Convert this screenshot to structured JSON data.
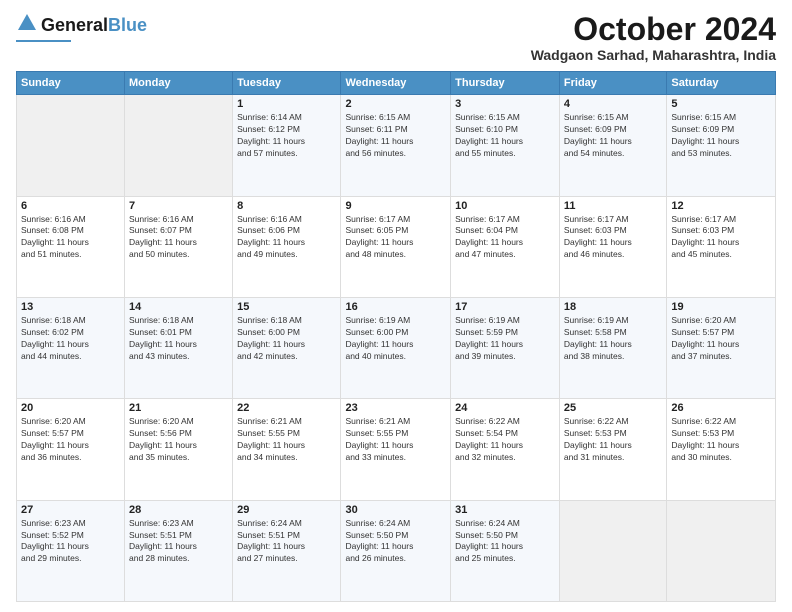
{
  "header": {
    "logo_line1": "General",
    "logo_line2": "Blue",
    "month": "October 2024",
    "location": "Wadgaon Sarhad, Maharashtra, India"
  },
  "weekdays": [
    "Sunday",
    "Monday",
    "Tuesday",
    "Wednesday",
    "Thursday",
    "Friday",
    "Saturday"
  ],
  "weeks": [
    [
      {
        "day": "",
        "info": ""
      },
      {
        "day": "",
        "info": ""
      },
      {
        "day": "1",
        "info": "Sunrise: 6:14 AM\nSunset: 6:12 PM\nDaylight: 11 hours\nand 57 minutes."
      },
      {
        "day": "2",
        "info": "Sunrise: 6:15 AM\nSunset: 6:11 PM\nDaylight: 11 hours\nand 56 minutes."
      },
      {
        "day": "3",
        "info": "Sunrise: 6:15 AM\nSunset: 6:10 PM\nDaylight: 11 hours\nand 55 minutes."
      },
      {
        "day": "4",
        "info": "Sunrise: 6:15 AM\nSunset: 6:09 PM\nDaylight: 11 hours\nand 54 minutes."
      },
      {
        "day": "5",
        "info": "Sunrise: 6:15 AM\nSunset: 6:09 PM\nDaylight: 11 hours\nand 53 minutes."
      }
    ],
    [
      {
        "day": "6",
        "info": "Sunrise: 6:16 AM\nSunset: 6:08 PM\nDaylight: 11 hours\nand 51 minutes."
      },
      {
        "day": "7",
        "info": "Sunrise: 6:16 AM\nSunset: 6:07 PM\nDaylight: 11 hours\nand 50 minutes."
      },
      {
        "day": "8",
        "info": "Sunrise: 6:16 AM\nSunset: 6:06 PM\nDaylight: 11 hours\nand 49 minutes."
      },
      {
        "day": "9",
        "info": "Sunrise: 6:17 AM\nSunset: 6:05 PM\nDaylight: 11 hours\nand 48 minutes."
      },
      {
        "day": "10",
        "info": "Sunrise: 6:17 AM\nSunset: 6:04 PM\nDaylight: 11 hours\nand 47 minutes."
      },
      {
        "day": "11",
        "info": "Sunrise: 6:17 AM\nSunset: 6:03 PM\nDaylight: 11 hours\nand 46 minutes."
      },
      {
        "day": "12",
        "info": "Sunrise: 6:17 AM\nSunset: 6:03 PM\nDaylight: 11 hours\nand 45 minutes."
      }
    ],
    [
      {
        "day": "13",
        "info": "Sunrise: 6:18 AM\nSunset: 6:02 PM\nDaylight: 11 hours\nand 44 minutes."
      },
      {
        "day": "14",
        "info": "Sunrise: 6:18 AM\nSunset: 6:01 PM\nDaylight: 11 hours\nand 43 minutes."
      },
      {
        "day": "15",
        "info": "Sunrise: 6:18 AM\nSunset: 6:00 PM\nDaylight: 11 hours\nand 42 minutes."
      },
      {
        "day": "16",
        "info": "Sunrise: 6:19 AM\nSunset: 6:00 PM\nDaylight: 11 hours\nand 40 minutes."
      },
      {
        "day": "17",
        "info": "Sunrise: 6:19 AM\nSunset: 5:59 PM\nDaylight: 11 hours\nand 39 minutes."
      },
      {
        "day": "18",
        "info": "Sunrise: 6:19 AM\nSunset: 5:58 PM\nDaylight: 11 hours\nand 38 minutes."
      },
      {
        "day": "19",
        "info": "Sunrise: 6:20 AM\nSunset: 5:57 PM\nDaylight: 11 hours\nand 37 minutes."
      }
    ],
    [
      {
        "day": "20",
        "info": "Sunrise: 6:20 AM\nSunset: 5:57 PM\nDaylight: 11 hours\nand 36 minutes."
      },
      {
        "day": "21",
        "info": "Sunrise: 6:20 AM\nSunset: 5:56 PM\nDaylight: 11 hours\nand 35 minutes."
      },
      {
        "day": "22",
        "info": "Sunrise: 6:21 AM\nSunset: 5:55 PM\nDaylight: 11 hours\nand 34 minutes."
      },
      {
        "day": "23",
        "info": "Sunrise: 6:21 AM\nSunset: 5:55 PM\nDaylight: 11 hours\nand 33 minutes."
      },
      {
        "day": "24",
        "info": "Sunrise: 6:22 AM\nSunset: 5:54 PM\nDaylight: 11 hours\nand 32 minutes."
      },
      {
        "day": "25",
        "info": "Sunrise: 6:22 AM\nSunset: 5:53 PM\nDaylight: 11 hours\nand 31 minutes."
      },
      {
        "day": "26",
        "info": "Sunrise: 6:22 AM\nSunset: 5:53 PM\nDaylight: 11 hours\nand 30 minutes."
      }
    ],
    [
      {
        "day": "27",
        "info": "Sunrise: 6:23 AM\nSunset: 5:52 PM\nDaylight: 11 hours\nand 29 minutes."
      },
      {
        "day": "28",
        "info": "Sunrise: 6:23 AM\nSunset: 5:51 PM\nDaylight: 11 hours\nand 28 minutes."
      },
      {
        "day": "29",
        "info": "Sunrise: 6:24 AM\nSunset: 5:51 PM\nDaylight: 11 hours\nand 27 minutes."
      },
      {
        "day": "30",
        "info": "Sunrise: 6:24 AM\nSunset: 5:50 PM\nDaylight: 11 hours\nand 26 minutes."
      },
      {
        "day": "31",
        "info": "Sunrise: 6:24 AM\nSunset: 5:50 PM\nDaylight: 11 hours\nand 25 minutes."
      },
      {
        "day": "",
        "info": ""
      },
      {
        "day": "",
        "info": ""
      }
    ]
  ]
}
